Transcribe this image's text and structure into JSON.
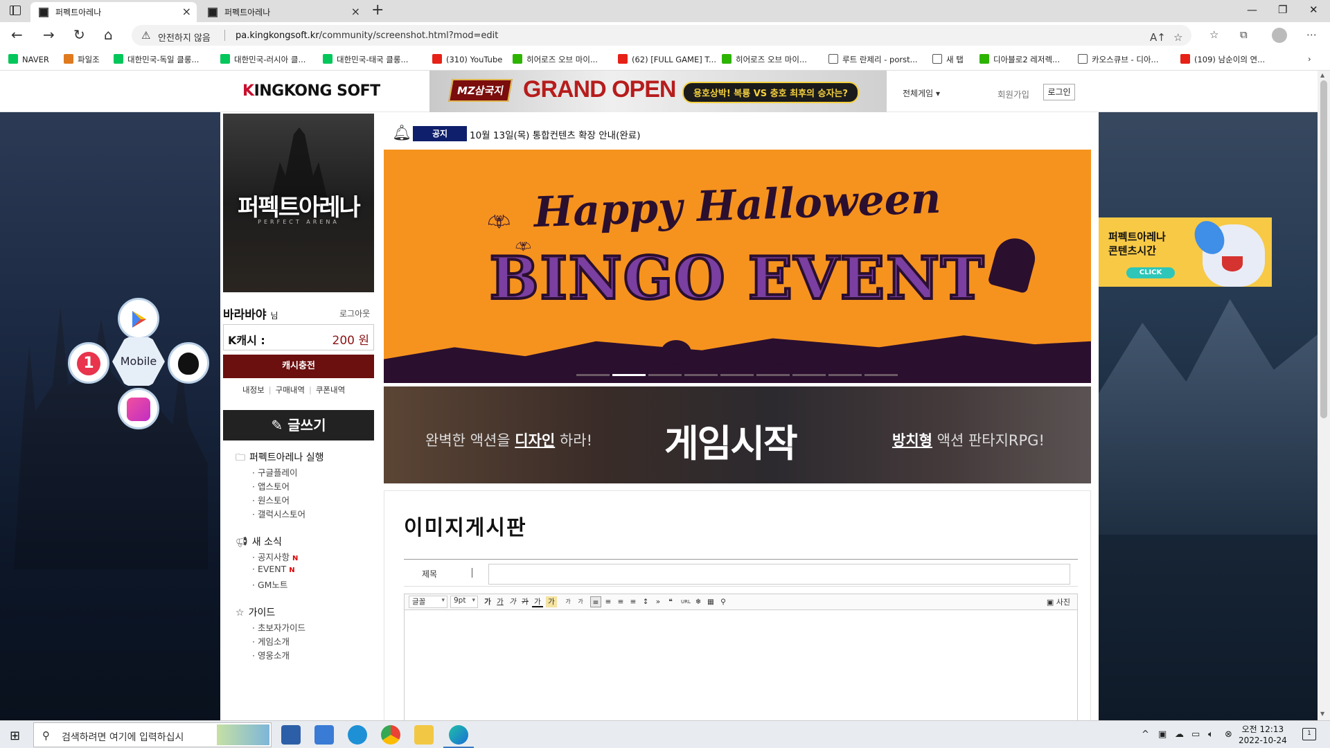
{
  "browser": {
    "tabs": [
      {
        "title": "퍼펙트아레나"
      },
      {
        "title": "퍼펙트아레나"
      }
    ],
    "address": {
      "security_label": "안전하지 않음",
      "host": "pa.kingkongsoft.kr",
      "path": "/community/screenshot.html?mod=edit"
    },
    "bookmarks": [
      {
        "label": "NAVER",
        "icon": "naver-icon",
        "color": "#03c75a"
      },
      {
        "label": "파일조",
        "icon": "filejo-icon",
        "color": "#e07a1f"
      },
      {
        "label": "대한민국-독일 클롱...",
        "icon": "naver-icon",
        "color": "#03c75a"
      },
      {
        "label": "대한민국-러시아 클...",
        "icon": "naver-icon",
        "color": "#03c75a"
      },
      {
        "label": "대한민국-태국 클롱...",
        "icon": "naver-icon",
        "color": "#03c75a"
      },
      {
        "label": "(310) YouTube",
        "icon": "youtube-icon",
        "color": "#e62117"
      },
      {
        "label": "히어로즈 오브 마이...",
        "icon": "blog-icon",
        "color": "#2db400"
      },
      {
        "label": "(62) [FULL GAME] T...",
        "icon": "youtube-icon",
        "color": "#e62117"
      },
      {
        "label": "히어로즈 오브 마이...",
        "icon": "blog-icon",
        "color": "#2db400"
      },
      {
        "label": "루트 란제리 - porst...",
        "icon": "page-icon",
        "color": "#ffffff"
      },
      {
        "label": "새 탭",
        "icon": "newtab-icon",
        "color": "#ffffff"
      },
      {
        "label": "디아블로2 레저렉...",
        "icon": "cafe-icon",
        "color": "#2db400"
      },
      {
        "label": "카오스큐브 - 디아...",
        "icon": "ch-icon",
        "color": "#ffffff"
      },
      {
        "label": "(109) 남순이의 연...",
        "icon": "youtube-icon",
        "color": "#e62117"
      }
    ]
  },
  "site": {
    "logo": {
      "k": "K",
      "rest": "INGKONG SOFT"
    },
    "top_banner": {
      "game": "MZ삼국지",
      "title": "GRAND OPEN",
      "subtitle": "용호상박! 복룡 VS 충호 최후의 승자는?"
    },
    "all_games": "전체게임 ▾",
    "join": "회원가입",
    "login": "로그인"
  },
  "sidebar": {
    "poster_title": "퍼펙트아레나",
    "poster_sub": "PERFECT ARENA",
    "user_name": "바라바야",
    "user_suffix": "님",
    "logout": "로그아웃",
    "kcash_label": "K캐시 :",
    "kcash_value": "200 원",
    "charge": "캐시충전",
    "links": [
      "내정보",
      "구매내역",
      "쿠폰내역"
    ],
    "write": "글쓰기",
    "sections": [
      {
        "title": "퍼펙트아레나 실행",
        "icon": "folder-icon",
        "items": [
          {
            "label": "구글플레이"
          },
          {
            "label": "앱스토어"
          },
          {
            "label": "원스토어"
          },
          {
            "label": "갤럭시스토어"
          }
        ]
      },
      {
        "title": "새 소식",
        "icon": "megaphone-icon",
        "items": [
          {
            "label": "공지사항",
            "new": "N"
          },
          {
            "label": "EVENT",
            "new": "N"
          },
          {
            "label": "GM노트"
          }
        ]
      },
      {
        "title": "가이드",
        "icon": "star-icon",
        "items": [
          {
            "label": "초보자가이드"
          },
          {
            "label": "게임소개"
          },
          {
            "label": "영웅소개"
          }
        ]
      }
    ]
  },
  "mobile_widget": {
    "center": "Mobile",
    "onestore": "1"
  },
  "main": {
    "notice_badge": "공지",
    "notice_text": "10월 13일(목) 통합컨텐츠 확장 안내(완료)",
    "halloween": {
      "line1": "Happy Halloween",
      "line2": "BINGO EVENT",
      "slides": 9,
      "active_slide": 2
    },
    "start_banner": {
      "left_pre": "완벽한 액션을 ",
      "left_bold": "디자인",
      "left_post": " 하라!",
      "center": "게임시작",
      "right_bold": "방치형",
      "right_post": " 액션 판타지RPG!"
    },
    "board_title": "이미지게시판",
    "form": {
      "title_label": "제목",
      "title_value": ""
    },
    "editor": {
      "font": "글꼴",
      "size": "9pt",
      "buttons": [
        "가",
        "가",
        "가",
        "가",
        "가",
        "가",
        "가",
        "가"
      ],
      "photo": "사진"
    }
  },
  "float_event": {
    "line1": "퍼펙트아레나",
    "line2": "콘텐츠시간",
    "button": "CLICK"
  },
  "taskbar": {
    "search_placeholder": "검색하려면 여기에 입력하십시",
    "time": "오전 12:13",
    "date": "2022-10-24",
    "notif_count": "1"
  },
  "colors": {
    "brand_red": "#c8102e",
    "charge_bg": "#6b0f0f",
    "notice_badge": "#0f1f6b",
    "halloween_bg": "#f6931e"
  }
}
